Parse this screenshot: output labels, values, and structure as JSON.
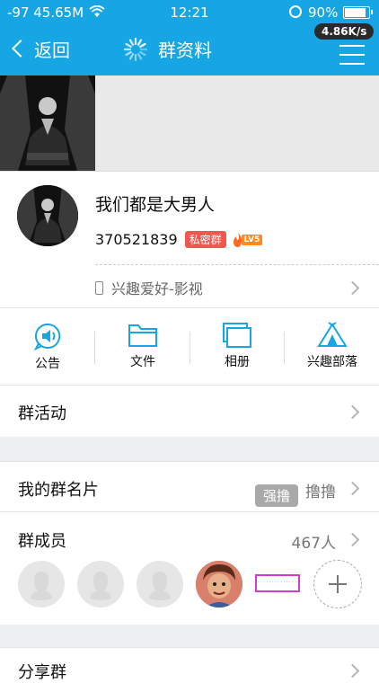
{
  "status_bar": {
    "signal": "-97 45.65M",
    "time": "12:21",
    "battery": "90%",
    "battery_level": 0.9
  },
  "nav": {
    "back_label": "返回",
    "title": "群资料",
    "net_speed": "4.86K/s",
    "menu_icon": "menu-icon"
  },
  "group": {
    "name": "我们都是大男人",
    "id": "370521839",
    "private_tag": "私密群",
    "level_tag": "LV5",
    "interest": "兴趣爱好-影视"
  },
  "actions": [
    {
      "label": "公告",
      "icon": "announcement-icon"
    },
    {
      "label": "文件",
      "icon": "folder-icon"
    },
    {
      "label": "相册",
      "icon": "album-icon"
    },
    {
      "label": "兴趣部落",
      "icon": "tribe-icon"
    }
  ],
  "rows": {
    "activity": "群活动",
    "card_label": "我的群名片",
    "card_value": "撸撸",
    "members_label": "群成员",
    "members_count": "467人",
    "share_label": "分享群"
  },
  "badge": "强撸",
  "colors": {
    "accent": "#16a6e4",
    "private": "#f0574f"
  }
}
